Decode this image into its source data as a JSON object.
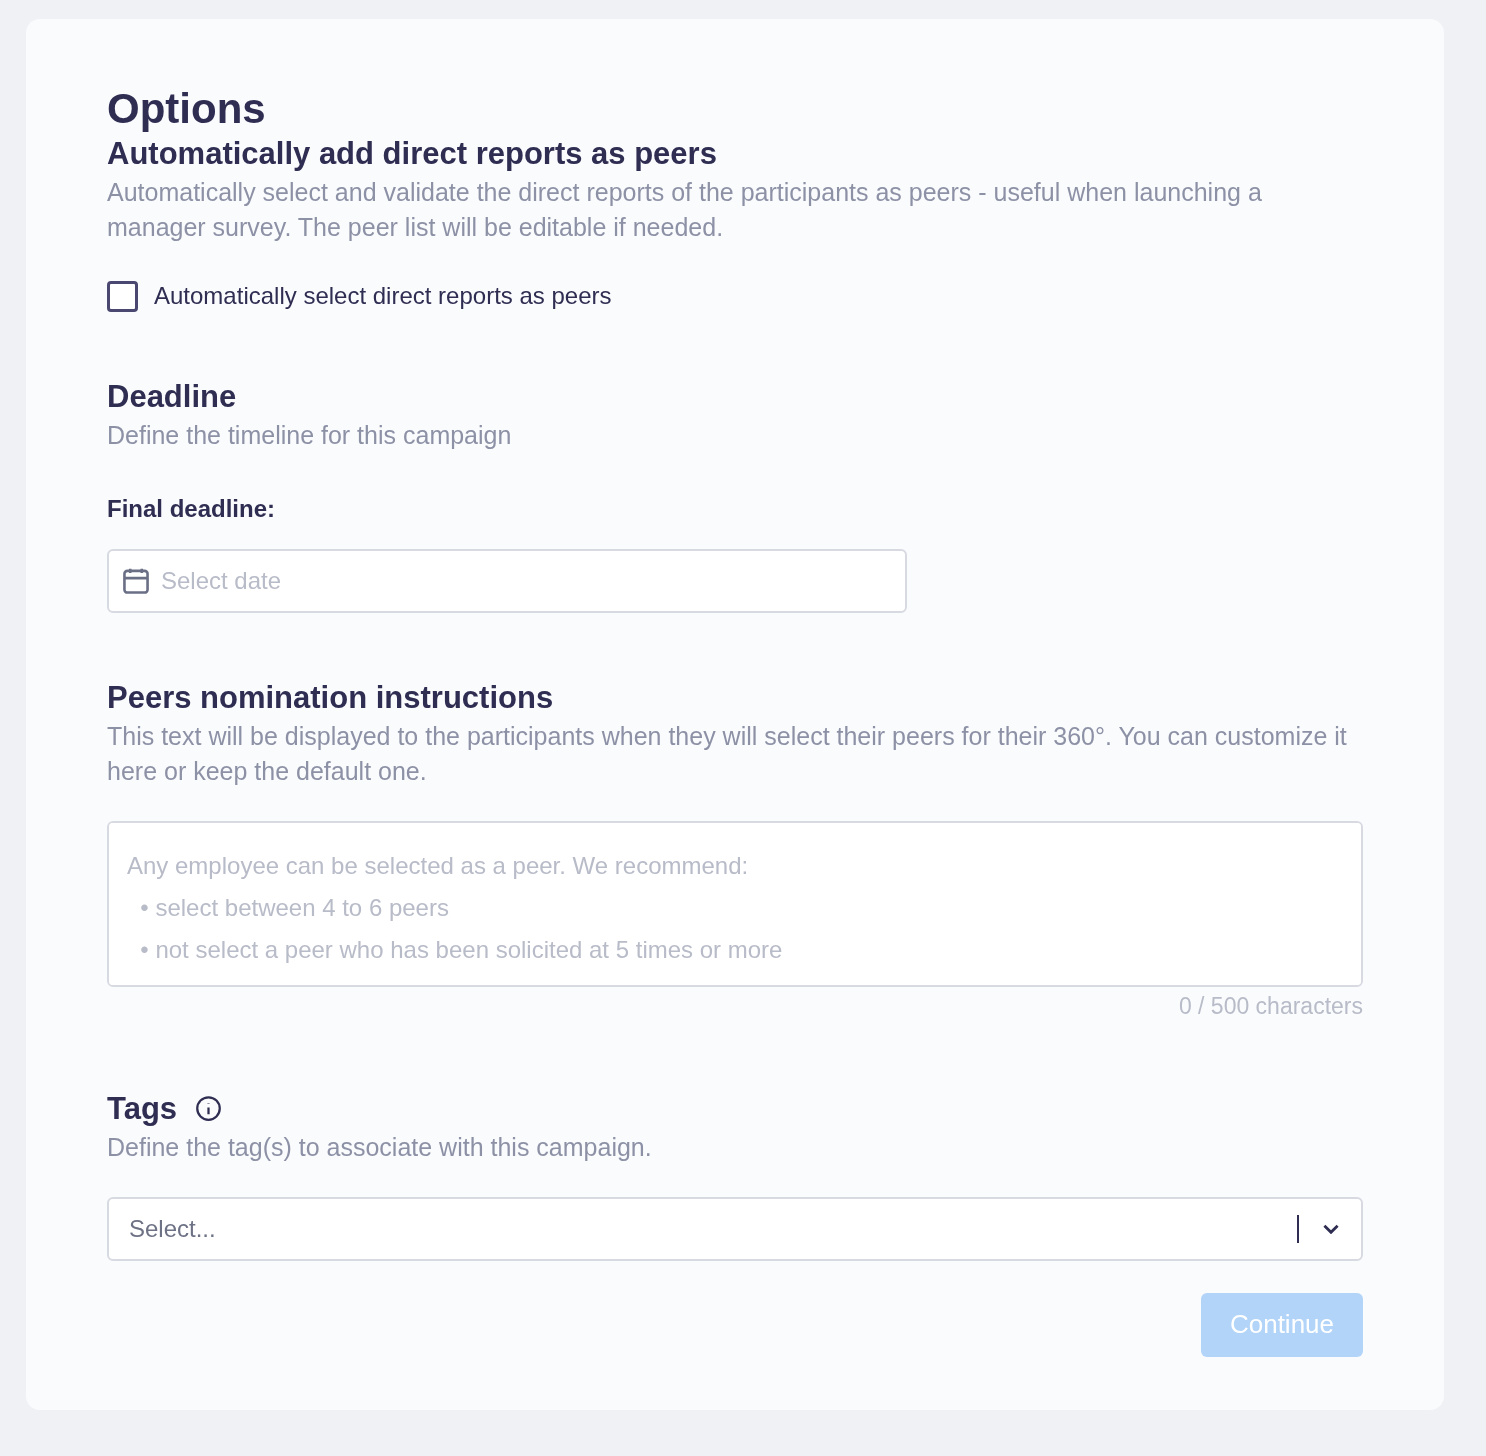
{
  "title": "Options",
  "direct_reports": {
    "heading": "Automatically add direct reports as peers",
    "description": "Automatically select and validate the direct reports of the participants as peers - useful when launching a manager survey. The peer list will be editable if needed.",
    "checkbox": {
      "label": "Automatically select direct reports as peers",
      "checked": false
    }
  },
  "deadline": {
    "heading": "Deadline",
    "description": "Define the timeline for this campaign",
    "field_label": "Final deadline:",
    "date_field": {
      "placeholder": "Select date"
    }
  },
  "instructions": {
    "heading": "Peers nomination instructions",
    "description": "This text will be displayed to the participants when they will select their peers for their 360°. You can customize it here or keep the default one.",
    "textarea": {
      "placeholder": "Any employee can be selected as a peer. We recommend:\n  • select between 4 to 6 peers\n  • not select a peer who has been solicited at 5 times or more"
    },
    "counter": "0 / 500 characters"
  },
  "tags": {
    "heading": "Tags",
    "description": "Define the tag(s) to associate with this campaign.",
    "select": {
      "placeholder": "Select..."
    }
  },
  "continue_button": {
    "label": "Continue",
    "disabled": true
  }
}
